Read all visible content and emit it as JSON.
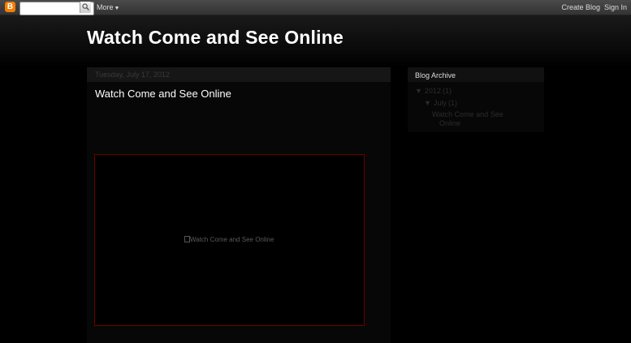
{
  "navbar": {
    "logo_letter": "B",
    "search_placeholder": "",
    "more_label": "More",
    "create_blog_label": "Create Blog",
    "sign_in_label": "Sign In"
  },
  "blog": {
    "title": "Watch Come and See Online"
  },
  "post": {
    "date": "Tuesday, July 17, 2012",
    "title": "Watch Come and See Online",
    "image_alt": "Watch Come and See Online"
  },
  "sidebar": {
    "archive_title": "Blog Archive",
    "year": {
      "toggle": "▼",
      "label": "2012",
      "count": "(1)"
    },
    "month": {
      "toggle": "▼",
      "label": "July",
      "count": "(1)"
    },
    "post_link_line1": "Watch Come and See",
    "post_link_line2": "Online"
  },
  "colors": {
    "background": "#000000",
    "navbar": "#3c3c3c",
    "image_border": "#6a0000",
    "title_text": "#ffffff"
  }
}
